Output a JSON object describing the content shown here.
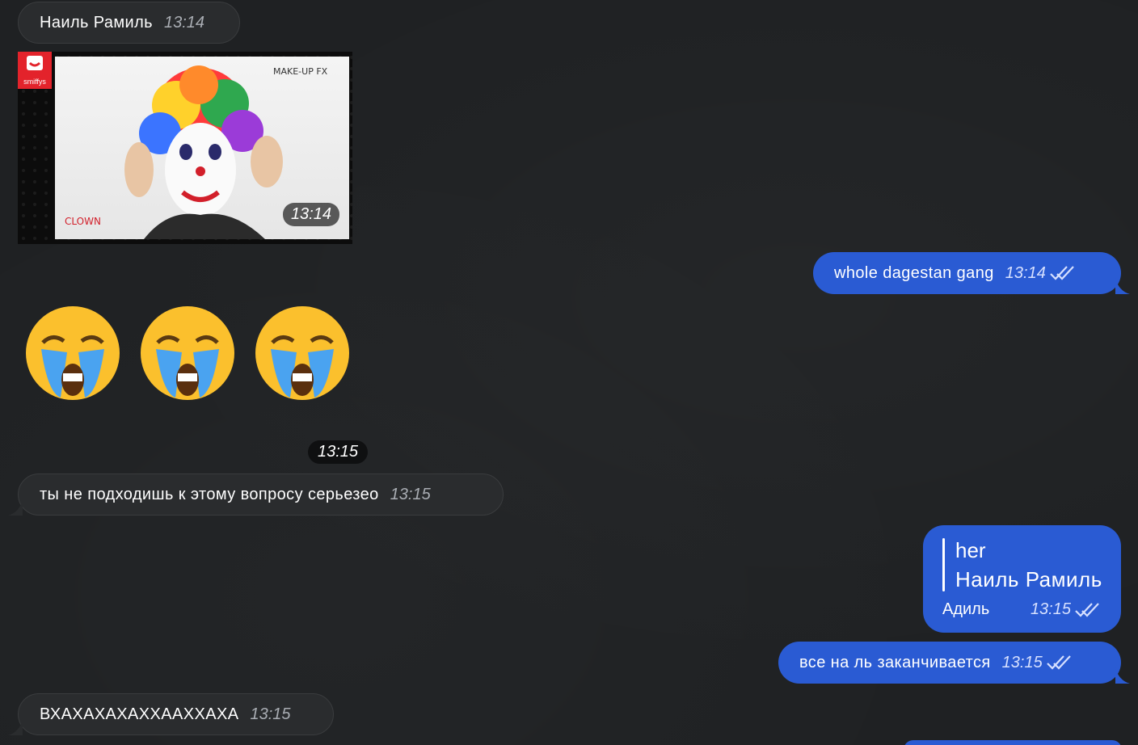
{
  "colors": {
    "background": "#1f2123",
    "incoming_bubble": "#2a2c2e",
    "outgoing_bubble": "#2a5bd3",
    "timestamp_in": "#a9adb3",
    "timestamp_out": "#d6e0ff"
  },
  "messages": [
    {
      "id": "msg1",
      "direction": "incoming",
      "text": "Наиль Рамиль",
      "time": "13:14"
    },
    {
      "id": "msg2",
      "direction": "incoming",
      "type": "gif",
      "caption": "CLOWN",
      "watermark": "MAKE-UP FX",
      "brand": "smiffys",
      "time": "13:14"
    },
    {
      "id": "msg3",
      "direction": "outgoing",
      "text": "whole dagestan gang",
      "time": "13:14",
      "status": "read-double-check-icon"
    },
    {
      "id": "msg4",
      "direction": "incoming",
      "type": "emoji",
      "emoji": [
        "loudly-crying-face",
        "loudly-crying-face",
        "loudly-crying-face"
      ],
      "time": "13:15"
    },
    {
      "id": "msg5",
      "direction": "incoming",
      "text": "ты не подходишь к этому вопросу серьезео",
      "time": "13:15"
    },
    {
      "id": "msg6",
      "direction": "outgoing",
      "quote_line1": "her",
      "quote_line2": "Наиль Рамиль",
      "text": "Адиль",
      "time": "13:15",
      "status": "read-double-check-icon"
    },
    {
      "id": "msg7",
      "direction": "outgoing",
      "text": "все на ль заканчивается",
      "time": "13:15",
      "status": "read-double-check-icon"
    },
    {
      "id": "msg8",
      "direction": "incoming",
      "text": "ВХАХАХАХАХХААХХАХА",
      "time": "13:15"
    }
  ]
}
